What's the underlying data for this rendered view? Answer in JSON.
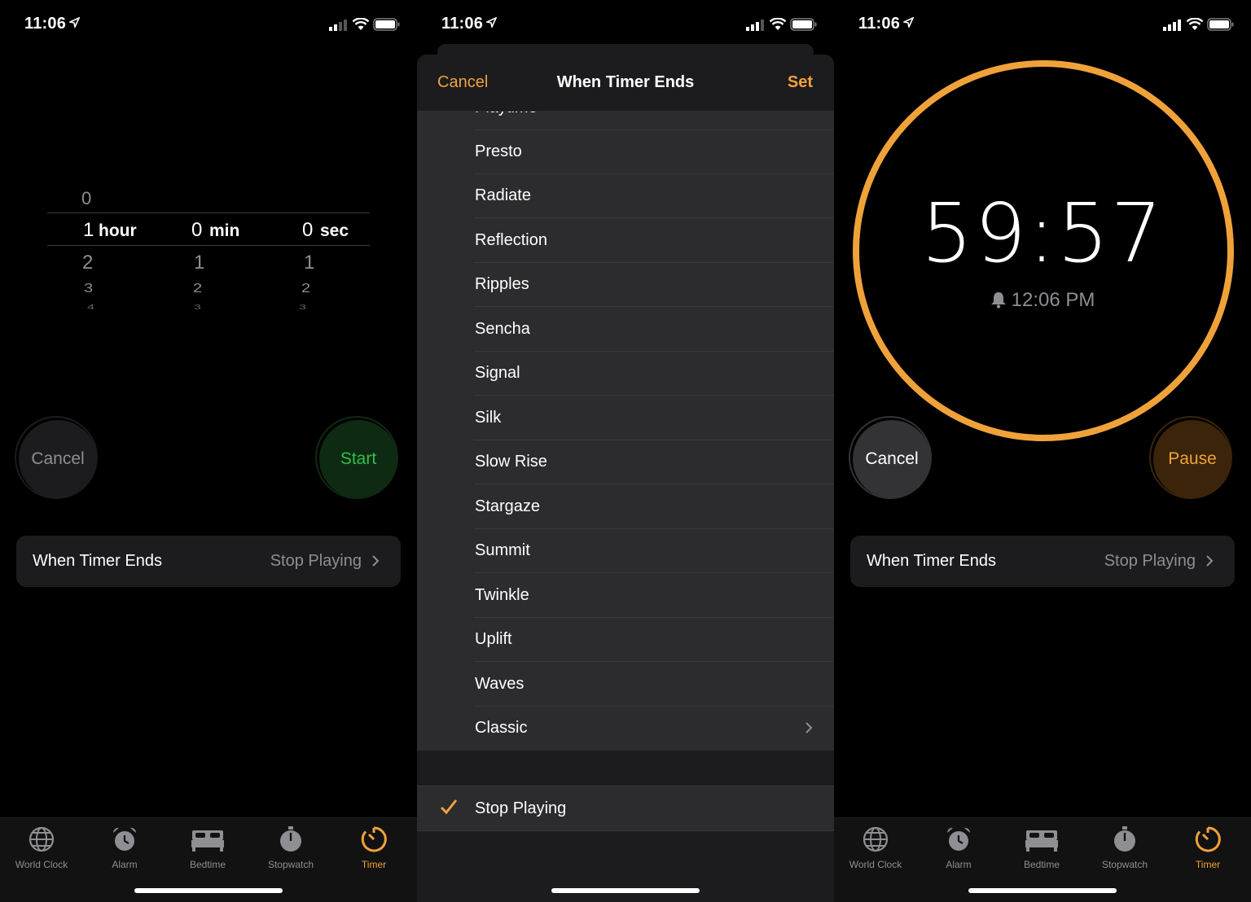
{
  "status": {
    "time": "11:06"
  },
  "picker": {
    "hours_above": "0",
    "hours_selected": "1",
    "hours_unit": "hour",
    "minutes_selected": "0",
    "minutes_unit": "min",
    "seconds_selected": "0",
    "seconds_unit": "sec",
    "hours_below": [
      "2",
      "3",
      "4"
    ],
    "minutes_below": [
      "1",
      "2",
      "3"
    ],
    "seconds_below": [
      "1",
      "2",
      "3"
    ]
  },
  "buttons": {
    "cancel": "Cancel",
    "start": "Start",
    "pause": "Pause"
  },
  "when_timer_ends": {
    "label": "When Timer Ends",
    "value": "Stop Playing"
  },
  "tabs": [
    {
      "label": "World Clock",
      "icon": "globe-icon"
    },
    {
      "label": "Alarm",
      "icon": "alarm-clock-icon"
    },
    {
      "label": "Bedtime",
      "icon": "bed-icon"
    },
    {
      "label": "Stopwatch",
      "icon": "stopwatch-icon"
    },
    {
      "label": "Timer",
      "icon": "timer-icon",
      "active": true
    }
  ],
  "sheet": {
    "cancel": "Cancel",
    "title": "When Timer Ends",
    "set": "Set",
    "partial_item": "Playtime",
    "sounds": [
      "Presto",
      "Radiate",
      "Reflection",
      "Ripples",
      "Sencha",
      "Signal",
      "Silk",
      "Slow Rise",
      "Stargaze",
      "Summit",
      "Twinkle",
      "Uplift",
      "Waves"
    ],
    "classic": "Classic",
    "stop_playing": "Stop Playing"
  },
  "running": {
    "remaining": "59:57",
    "ends_at": "12:06 PM",
    "progress_fraction": 1.0
  },
  "colors": {
    "accent": "#f0a23a",
    "start_green": "#2fbf4a",
    "background": "#000000",
    "card": "#1c1c1e"
  }
}
